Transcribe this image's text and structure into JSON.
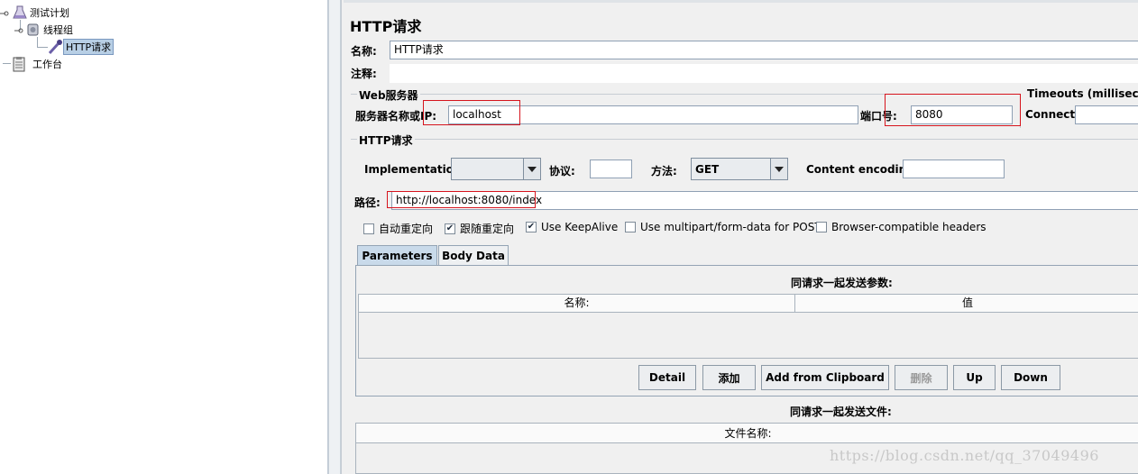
{
  "tree": {
    "items": [
      {
        "label": "测试计划",
        "icon": "flask-icon"
      },
      {
        "label": "线程组",
        "icon": "gear-icon"
      },
      {
        "label": "HTTP请求",
        "icon": "pipette-icon",
        "selected": true
      },
      {
        "label": "工作台",
        "icon": "clipboard-icon"
      }
    ]
  },
  "form": {
    "title": "HTTP请求",
    "name_label": "名称:",
    "name_value": "HTTP请求",
    "comment_label": "注释:",
    "web_server": {
      "legend": "Web服务器",
      "server_label": "服务器名称或IP:",
      "server_value": "localhost",
      "port_label": "端口号:",
      "port_value": "8080"
    },
    "timeouts": {
      "legend": "Timeouts (milliseconds)",
      "connect_label": "Connect:"
    },
    "http_request": {
      "legend": "HTTP请求",
      "implementation_label": "Implementation:",
      "implementation_value": "",
      "protocol_label": "协议:",
      "protocol_value": "",
      "method_label": "方法:",
      "method_value": "GET",
      "encoding_label": "Content encoding:",
      "encoding_value": "",
      "path_label": "路径:",
      "path_value": "http://localhost:8080/index"
    },
    "options": [
      {
        "label": "自动重定向",
        "checked": false
      },
      {
        "label": "跟随重定向",
        "checked": true
      },
      {
        "label": "Use KeepAlive",
        "checked": true
      },
      {
        "label": "Use multipart/form-data for POST",
        "checked": false
      },
      {
        "label": "Browser-compatible headers",
        "checked": false
      }
    ],
    "tabs": [
      {
        "label": "Parameters",
        "active": true
      },
      {
        "label": "Body Data",
        "active": false
      }
    ],
    "params": {
      "title": "同请求一起发送参数:",
      "columns": [
        "名称:",
        "值"
      ]
    },
    "buttons": [
      {
        "label": "Detail",
        "enabled": true
      },
      {
        "label": "添加",
        "enabled": true
      },
      {
        "label": "Add from Clipboard",
        "enabled": true
      },
      {
        "label": "删除",
        "enabled": false
      },
      {
        "label": "Up",
        "enabled": true
      },
      {
        "label": "Down",
        "enabled": true
      }
    ],
    "files": {
      "title": "同请求一起发送文件:",
      "column": "文件名称:"
    }
  },
  "watermark": "https://blog.csdn.net/qq_37049496",
  "colors": {
    "highlight_red": "#d6141d",
    "selection": "#b8cfe5",
    "tab_active": "#c9daea"
  }
}
